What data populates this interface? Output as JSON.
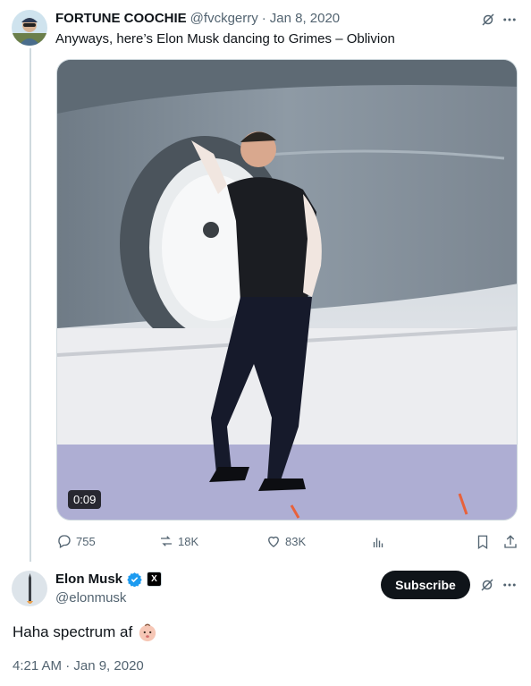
{
  "parent_tweet": {
    "display_name": "FORTUNE COOCHIE",
    "handle": "@fvckgerry",
    "separator": "·",
    "date": "Jan 8, 2020",
    "text": "Anyways, here’s Elon Musk dancing to Grimes – Oblivion",
    "video": {
      "duration": "0:09"
    },
    "stats": {
      "replies": "755",
      "reposts": "18K",
      "likes": "83K"
    }
  },
  "reply_tweet": {
    "display_name": "Elon Musk",
    "handle": "@elonmusk",
    "subscribe_label": "Subscribe",
    "text": "Haha spectrum af",
    "timestamp": "4:21 AM · Jan 9, 2020"
  },
  "icons": {
    "grok": "grok-icon",
    "more": "more-icon",
    "reply": "reply-icon",
    "repost": "repost-icon",
    "like": "like-icon",
    "views": "views-icon",
    "bookmark": "bookmark-icon",
    "share": "share-icon",
    "verified": "verified-badge-icon",
    "affiliate": "x-affiliate-icon",
    "emoji": "baby-face-emoji"
  },
  "colors": {
    "verified": "#1d9bf0",
    "text": "#0f1419",
    "muted": "#536471",
    "subscribe_bg": "#0f1419"
  }
}
